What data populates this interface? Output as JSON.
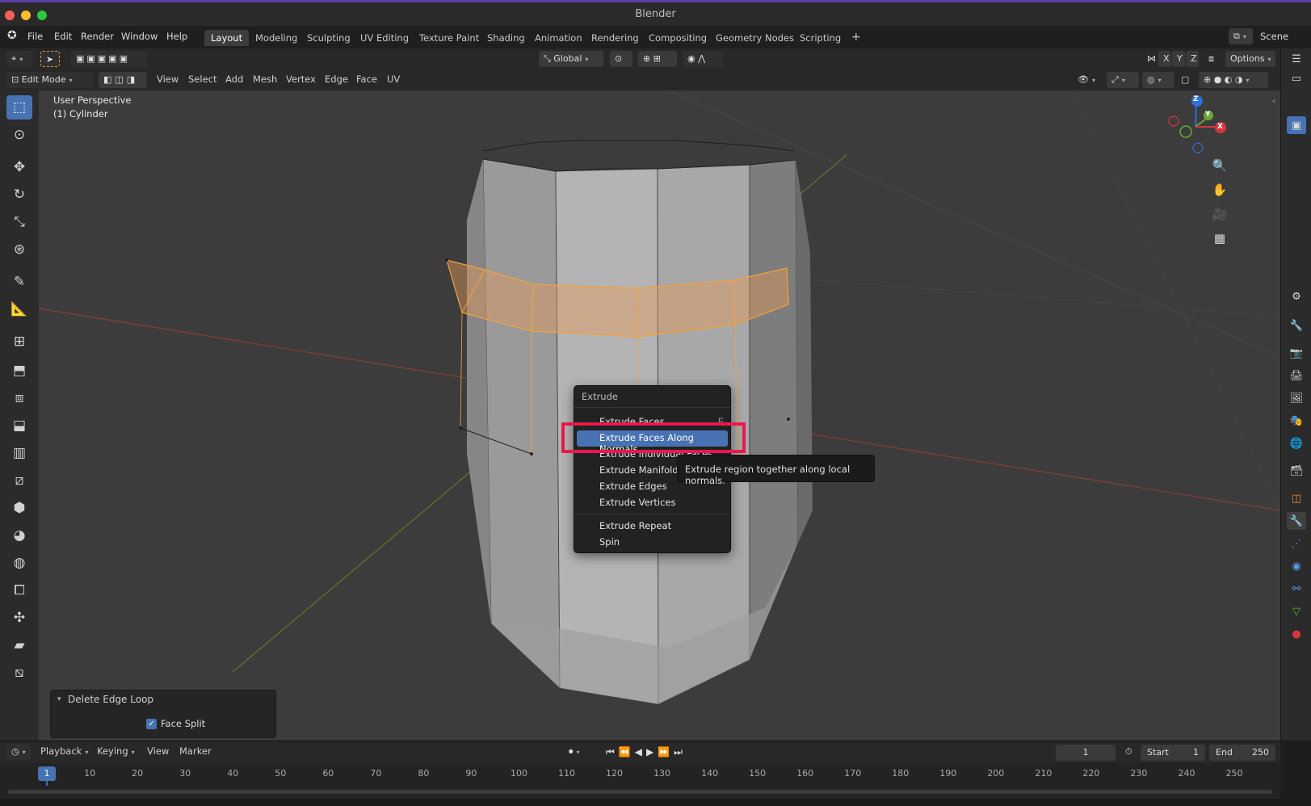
{
  "window": {
    "title": "Blender"
  },
  "menubar": {
    "menus": [
      "File",
      "Edit",
      "Render",
      "Window",
      "Help"
    ],
    "workspaces": [
      "Layout",
      "Modeling",
      "Sculpting",
      "UV Editing",
      "Texture Paint",
      "Shading",
      "Animation",
      "Rendering",
      "Compositing",
      "Geometry Nodes",
      "Scripting"
    ],
    "add_tab": "+",
    "scene": "Scene"
  },
  "toolheader": {
    "orientation": "Global",
    "axes": [
      "X",
      "Y",
      "Z"
    ],
    "options": "Options"
  },
  "editheader": {
    "mode": "Edit Mode",
    "menus": [
      "View",
      "Select",
      "Add",
      "Mesh",
      "Vertex",
      "Edge",
      "Face",
      "UV"
    ]
  },
  "viewport": {
    "perspective": "User Perspective",
    "object": "(1) Cylinder",
    "gizmo": {
      "z": "Z",
      "y": "Y",
      "x": "X"
    }
  },
  "extrude_menu": {
    "title": "Extrude",
    "items": [
      "Extrude Faces",
      "Extrude Faces Along Normals",
      "Extrude Individual Faces",
      "Extrude Manifold",
      "Extrude Edges",
      "Extrude Vertices",
      "Extrude Repeat",
      "Spin"
    ],
    "shortcut_first": "E",
    "highlighted": "Extrude Faces Along Normals"
  },
  "tooltip": {
    "text": "Extrude region together along local normals."
  },
  "last_operator": {
    "title": "Delete Edge Loop",
    "checkbox_label": "Face Split",
    "checked": true
  },
  "timeline": {
    "menus": [
      "Playback",
      "Keying",
      "View",
      "Marker"
    ],
    "current_frame": "1",
    "start_label": "Start",
    "start": "1",
    "end_label": "End",
    "end": "250",
    "ruler": [
      "1",
      "10",
      "20",
      "30",
      "40",
      "50",
      "60",
      "70",
      "80",
      "90",
      "100",
      "110",
      "120",
      "130",
      "140",
      "150",
      "160",
      "170",
      "180",
      "190",
      "200",
      "210",
      "220",
      "230",
      "240",
      "250"
    ]
  },
  "colors": {
    "accent": "#4772b3",
    "highlight_box": "#e8194c",
    "selection": "#f5a23c"
  }
}
